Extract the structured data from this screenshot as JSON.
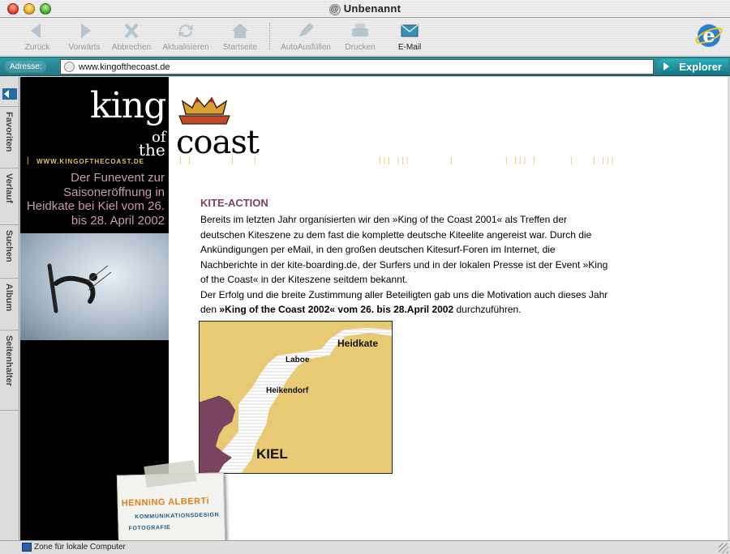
{
  "window": {
    "title": "Unbenannt"
  },
  "toolbar": {
    "back": "Zurück",
    "forward": "Vorwärts",
    "stop": "Abbrechen",
    "refresh": "Aktualisieren",
    "home": "Startseite",
    "autofill": "AutoAusfüllen",
    "print": "Drucken",
    "email": "E-Mail"
  },
  "address": {
    "label": "Adresse:",
    "value": "www.kingofthecoast.de",
    "go_label": "Explorer"
  },
  "sidebar": {
    "tabs": [
      "Favoriten",
      "Verlauf",
      "Suchen",
      "Album",
      "Seitenhalter"
    ]
  },
  "page": {
    "logo": {
      "king": "king",
      "of": "of",
      "the": "the",
      "coast": "coast"
    },
    "site_url": "WWW.KINGOFTHECOAST.DE",
    "promo": "Der Funevent zur Saisoneröffnung in Heidkate bei Kiel vom 26. bis 28. April 2002",
    "heading": "KITE-ACTION",
    "para1": "Bereits im letzten Jahr organisierten wir den »King of the Coast 2001« als Treffen der deutschen Kiteszene zu dem fast die komplette deutsche Kiteelite angereist war. Durch die Ankündigungen per eMail, in den großen deutschen Kitesurf-Foren im Internet, die Nachberichte in der kite-boarding.de, der Surfers und in der lokalen Presse ist der Event »King of the Coast« in der Kiteszene seitdem bekannt.",
    "para2_pre": "Der Erfolg und die breite Zustimmung aller Beteiligten gab uns die Motivation auch dieses Jahr den ",
    "para2_bold": "»King of the Coast 2002« vom 26. bis 28.April 2002",
    "para2_post": " durchzuführen.",
    "map": {
      "heidkate": "Heidkate",
      "laboe": "Laboe",
      "heikendorf": "Heikendorf",
      "kiel": "KIEL"
    },
    "stamp": {
      "name": "HENNiNG ALBERTi",
      "line1": "KOMMUNIKATIONSDESIGN",
      "line2": "FOTOGRAFIE"
    }
  },
  "status": {
    "text": "Zone für lokale Computer"
  },
  "colors": {
    "accent": "#1f7884",
    "heading": "#7d3f62",
    "map_land": "#e7ca73",
    "map_kiel": "#7a4460"
  }
}
